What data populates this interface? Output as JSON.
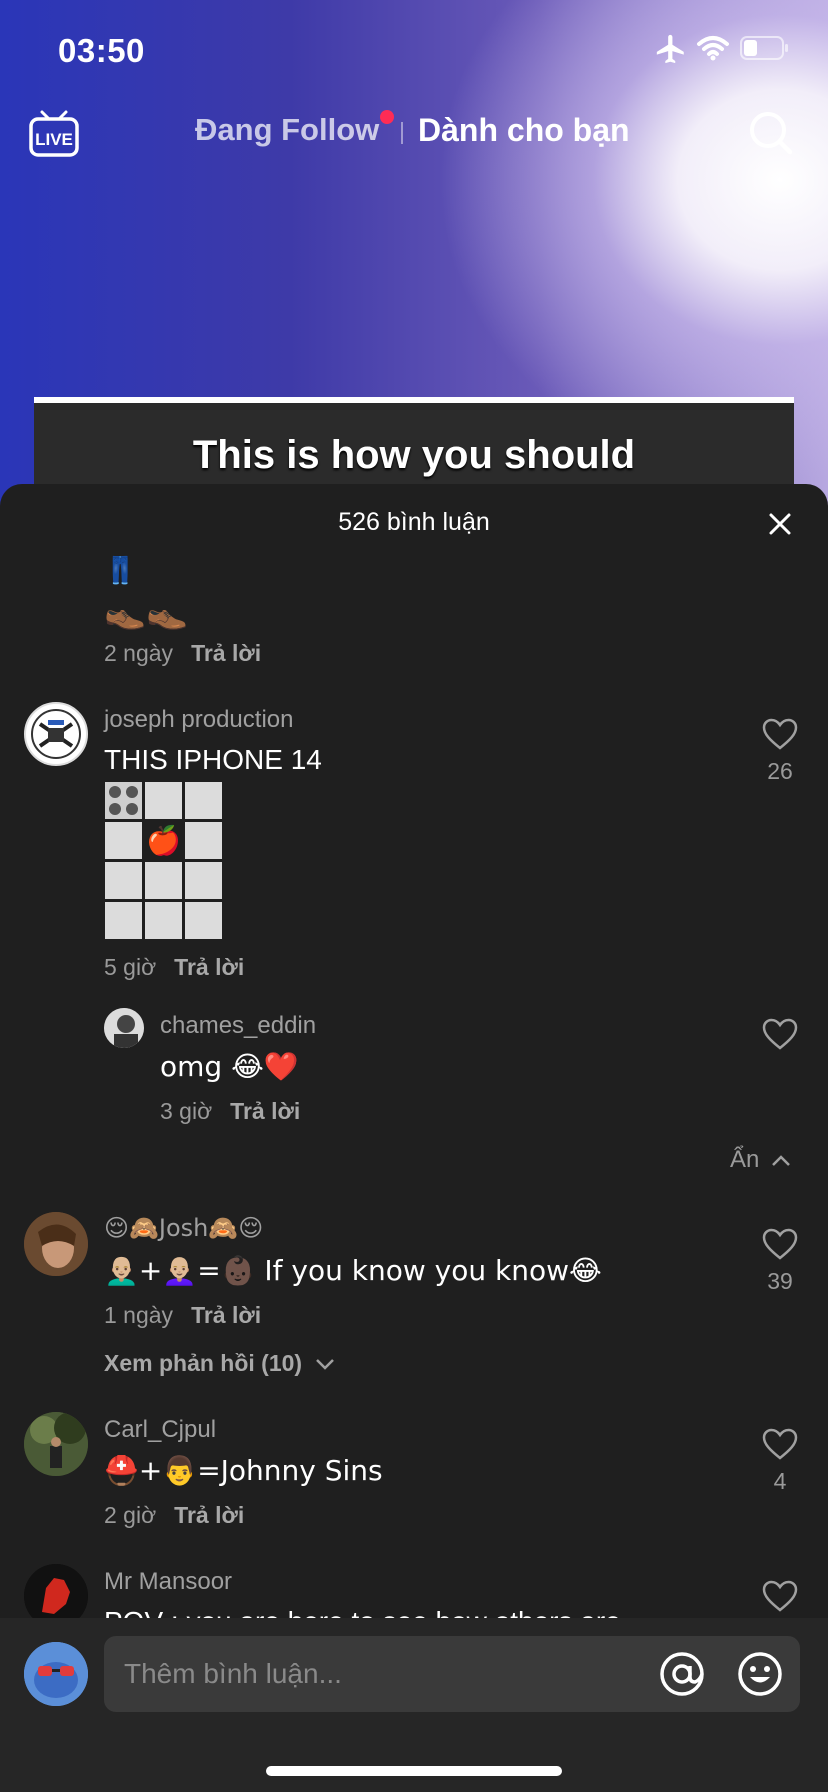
{
  "status_bar": {
    "time": "03:50"
  },
  "top_nav": {
    "live_label": "LIVE",
    "following": "Đang Follow",
    "for_you": "Dành cho bạn"
  },
  "video": {
    "caption": "This is how you should"
  },
  "comments_sheet": {
    "title": "526 bình luận",
    "reply_label": "Trả lời",
    "comments": [
      {
        "emoji_line1": "👖",
        "emoji_line2": "👞👞",
        "time": "2 ngày"
      },
      {
        "username": "joseph production",
        "text": "THIS IPHONE 14",
        "grid_center": "🍎",
        "time": "5 giờ",
        "likes": "26"
      },
      {
        "username": "chames_eddin",
        "text": "omg 😂❤️",
        "time": "3 giờ"
      },
      {
        "username": "😌🙈Josh🙈😌",
        "text": "👨🏼‍🦲+👩🏼‍🦲=👶🏿 If you know you know😂",
        "time": "1 ngày",
        "likes": "39"
      },
      {
        "username": "Carl_Cjpul",
        "text": "⛑️+👨=Johnny Sins",
        "time": "2 giờ",
        "likes": "4"
      },
      {
        "username": "Mr Mansoor",
        "text": "POV : you are here to see how others are"
      }
    ],
    "hide_label": "Ẩn",
    "view_replies": "Xem phản hồi (10)"
  },
  "composer": {
    "placeholder": "Thêm bình luận..."
  }
}
